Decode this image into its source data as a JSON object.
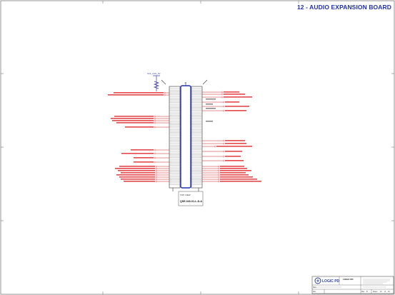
{
  "sheet_title": "12 - AUDIO EXPANSION BOARD",
  "colors": {
    "net_label": "#e0282b",
    "title": "#1f2fb0",
    "wire": "#c81e1e",
    "border": "#7a7a7a",
    "logo_blue": "#2a3f9a"
  },
  "connector": {
    "part_number": "QSE-040-01-L-D-A",
    "ref_text": "J?",
    "note": "TOP VIEW"
  },
  "power_label": "3V3_LDO_0V",
  "logo": {
    "brand": "LOGIC PD",
    "company": "LOGIC PD"
  },
  "title_block": {
    "size_label": "Size",
    "doc_label": "Doc",
    "sheet_label": "Sheet",
    "of_label": "of",
    "sheet_num": "12",
    "sheet_total": "16",
    "rev_label": "Rev",
    "rev_value": "B"
  }
}
